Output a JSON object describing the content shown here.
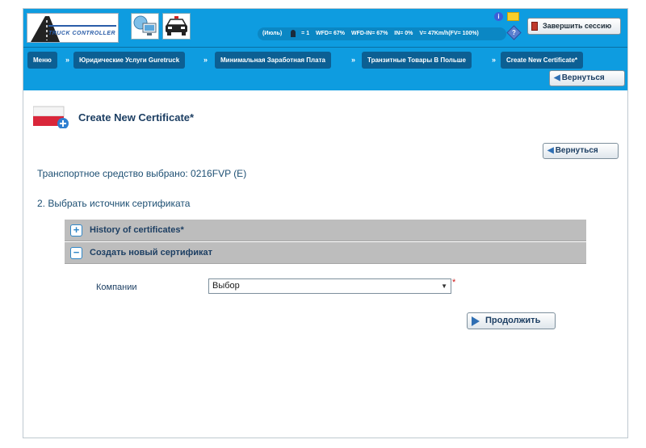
{
  "header": {
    "logo_text": "TRUCK CONTROLLER",
    "status": {
      "month": "(Июль)",
      "driver_count": "= 1",
      "wfd": "WFD= 67%",
      "wfd_in": "WFD-IN= 67%",
      "in": "IN= 0%",
      "v": "V= 47Km/h(FV= 100%)"
    },
    "logout_label": "Завершить сессию",
    "info_glyph": "i",
    "help_glyph": "?"
  },
  "breadcrumb": {
    "items": [
      {
        "label": "Меню"
      },
      {
        "label": "Юридические Услуги Guretruck"
      },
      {
        "label": "Минимальная Заработная Плата"
      },
      {
        "label": "Транзитные Товары В Польше"
      },
      {
        "label": "Create New Certificate*"
      }
    ],
    "separator": "»",
    "back_label": "Вернуться"
  },
  "main": {
    "title": "Create New Certificate*",
    "back_label": "Вернуться",
    "vehicle_text": "Транспортное средство выбрано: 0216FVP (E)",
    "step_text": "2. Выбрать источник сертификата",
    "accordion": [
      {
        "label": "History of certificates*",
        "toggle": "+"
      },
      {
        "label": "Создать новый сертификат",
        "toggle": "−"
      }
    ],
    "form": {
      "company_label": "Компании",
      "company_value": "Выбор",
      "required_mark": "*"
    },
    "continue_label": "Продолжить"
  },
  "colors": {
    "topbar": "#0e9ce0",
    "crumb": "#0c5f93",
    "accordion": "#bdbdbd",
    "text": "#1d3f63",
    "required": "#d01818"
  }
}
